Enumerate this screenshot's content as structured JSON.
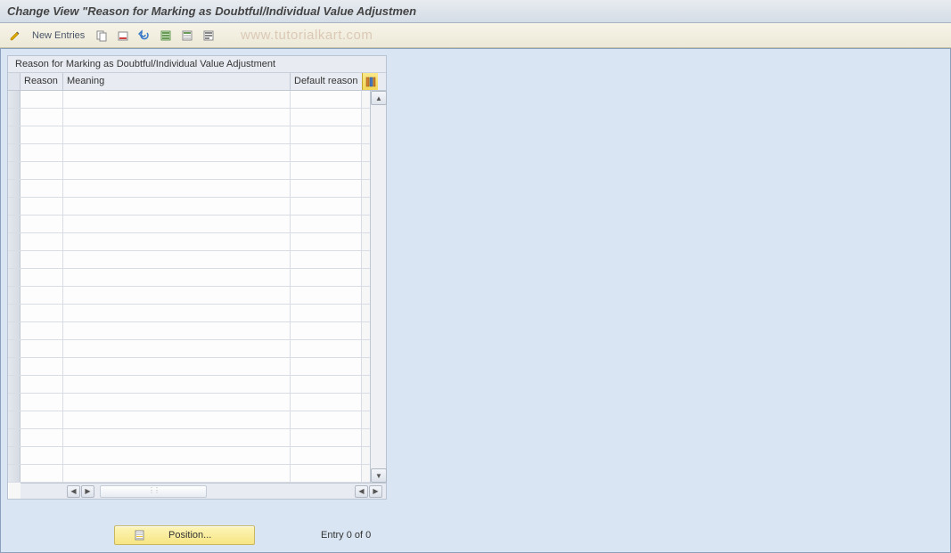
{
  "title": "Change View \"Reason for Marking as Doubtful/Individual Value Adjustmen",
  "toolbar": {
    "new_entries_label": "New Entries"
  },
  "watermark": "www.tutorialkart.com",
  "table": {
    "title": "Reason for Marking as Doubtful/Individual Value Adjustment",
    "columns": {
      "reason": "Reason",
      "meaning": "Meaning",
      "default_reason": "Default reason"
    },
    "row_count": 22
  },
  "footer": {
    "position_label": "Position...",
    "entry_text": "Entry 0 of 0"
  }
}
